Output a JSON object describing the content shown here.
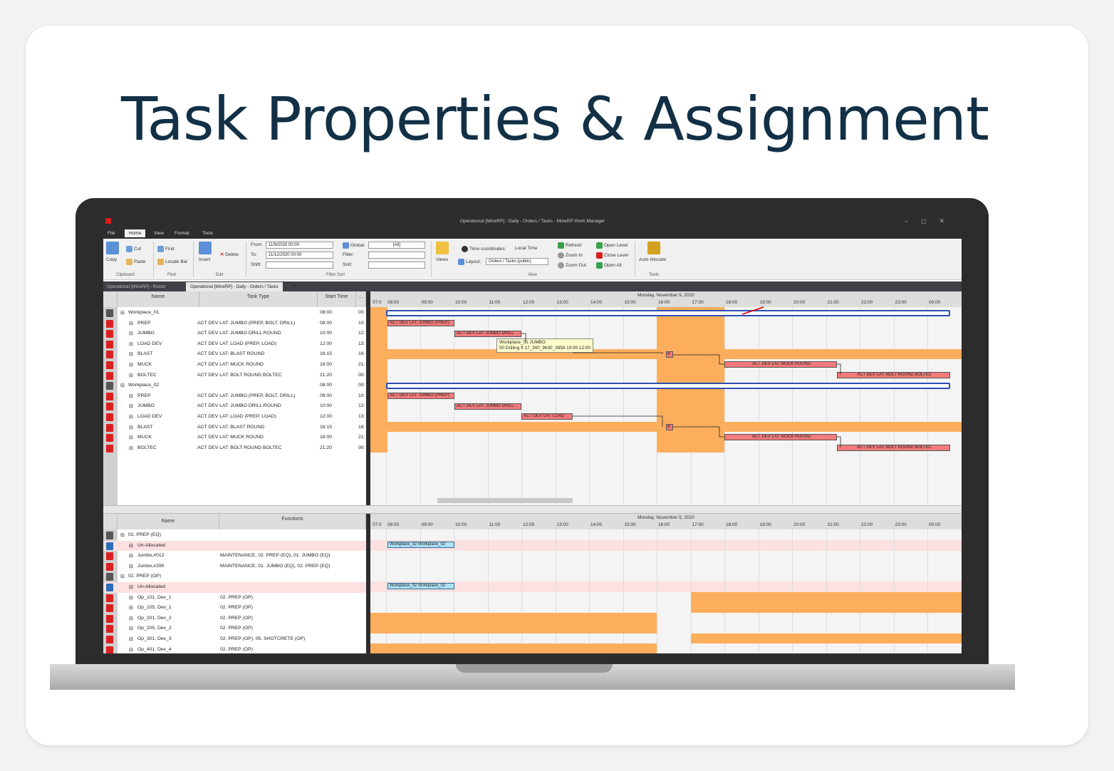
{
  "slide_title": "Task Properties & Assignment",
  "app": {
    "window_title": "Operational [MineRP] - Daily - Orders / Tasks - MineRP Work Manager",
    "menu": [
      "File",
      "Home",
      "View",
      "Format",
      "Tools"
    ],
    "ribbon": {
      "clipboard": {
        "copy": "Copy",
        "cut": "Cut",
        "paste": "Paste",
        "label": "Clipboard"
      },
      "find": {
        "find": "Find",
        "locate_bar": "Locate Bar",
        "label": "Find"
      },
      "edit": {
        "insert": "Insert",
        "delete": "Delete",
        "label": "Edit"
      },
      "filter": {
        "from_label": "From:",
        "from_value": "11/9/2020 00:00",
        "to_label": "To:",
        "to_value": "11/12/2020 00:00",
        "shift_label": "Shift:",
        "global_label": "Global:",
        "global_value": "[All]",
        "filter_label": "Filter:",
        "sort_label": "Sort:",
        "label": "Filter Sort"
      },
      "view": {
        "views": "Views",
        "time_coords_label": "Time coordinates:",
        "time_coords_value": "Local Time",
        "layout_label": "Layout:",
        "layout_value": "Orders / Tasks (public)",
        "refresh": "Refresh",
        "zoom_in": "Zoom In",
        "zoom_out": "Zoom Out",
        "open_level": "Open Level",
        "close_level": "Close Level",
        "open_all": "Open All",
        "label": "View"
      },
      "tools": {
        "auto_allocate": "Auto Allocate",
        "label": "Tools"
      }
    },
    "doc_tabs": [
      "Operational [MineRP] - Roster",
      "Operational [MineRP] - Daily - Orders / Tasks"
    ],
    "top_grid": {
      "headers": [
        "Name",
        "Task Type",
        "Start Time",
        "..."
      ],
      "rows": [
        {
          "name": "Workplace_01",
          "type": "",
          "start": "08:00",
          "end": "00:",
          "group": true
        },
        {
          "name": "PREP",
          "type": "ACT DEV LAT: JUMBO (PREP, BOLT, DRILL)",
          "start": "08:00",
          "end": "10:"
        },
        {
          "name": "JUMBO",
          "type": "ACT DEV LAT: JUMBO DRILL ROUND",
          "start": "10:00",
          "end": "12:"
        },
        {
          "name": "LOAD DEV",
          "type": "ACT DEV LAT: LOAD (PREP, LOAD)",
          "start": "12:00",
          "end": "13:"
        },
        {
          "name": "BLAST",
          "type": "ACT DEV LAT: BLAST ROUND",
          "start": "16:15",
          "end": "16:"
        },
        {
          "name": "MUCK",
          "type": "ACT DEV LAT: MUCK ROUND",
          "start": "18:00",
          "end": "21:"
        },
        {
          "name": "BOLTEC",
          "type": "ACT DEV LAT: BOLT ROUND BOLTEC",
          "start": "21:20",
          "end": "00:"
        },
        {
          "name": "Workplace_02",
          "type": "",
          "start": "08:00",
          "end": "00:",
          "group": true
        },
        {
          "name": "PREP",
          "type": "ACT DEV LAT: JUMBO (PREP, BOLT, DRILL)",
          "start": "08:00",
          "end": "10:"
        },
        {
          "name": "JUMBO",
          "type": "ACT DEV LAT: JUMBO DRILL ROUND",
          "start": "10:00",
          "end": "12:"
        },
        {
          "name": "LOAD DEV",
          "type": "ACT DEV LAT: LOAD (PREP, LOAD)",
          "start": "12:00",
          "end": "13:"
        },
        {
          "name": "BLAST",
          "type": "ACT DEV LAT: BLAST ROUND",
          "start": "16:15",
          "end": "16:"
        },
        {
          "name": "MUCK",
          "type": "ACT DEV LAT: MUCK ROUND",
          "start": "18:00",
          "end": "21:"
        },
        {
          "name": "BOLTEC",
          "type": "ACT DEV LAT: BOLT ROUND BOLTEC",
          "start": "21:20",
          "end": "00:"
        }
      ]
    },
    "gantt": {
      "date": "Monday, November 9, 2020",
      "hours": [
        "07:0",
        "08:00",
        "09:00",
        "10:00",
        "11:00",
        "12:00",
        "13:00",
        "14:00",
        "15:00",
        "16:00",
        "17:00",
        "18:00",
        "19:00",
        "20:00",
        "21:00",
        "22:00",
        "23:00",
        "00:00"
      ],
      "bars": {
        "prep": "ACT DEV LAT: JUMBO (PREP)",
        "jumbo1": "ACT DEV LAT: JUMBO DRILL",
        "jumbo2": "ACT DEV LAT: JUMBO DRILL...",
        "load": "ACT DEV LAT: LOAD",
        "blast": "B",
        "muck": "ACT DEV LAT: MUCK ROUND",
        "boltec": "ACT DEV LAT: BOLT ROUND BOLTEC"
      },
      "tooltip_line1": "Workplace_01 JUMBO",
      "tooltip_line2": "50 Drilling ft 17_300_9630_3958  10:00 12:00"
    },
    "bottom_grid": {
      "headers": [
        "Name",
        "Functions"
      ],
      "rows": [
        {
          "name": "02. PREP (EQ)",
          "func": "",
          "group": true
        },
        {
          "name": "Un-Allocated",
          "func": "",
          "pink": true
        },
        {
          "name": "Jumbo,#012",
          "func": "MAINTENANCE, 02. PREP (EQ), 01. JUMBO (EQ)"
        },
        {
          "name": "Jumbo,#290",
          "func": "MAINTENANCE, 01. JUMBO (EQ), 02. PREP (EQ)"
        },
        {
          "name": "02. PREP (OP)",
          "func": "",
          "group": true
        },
        {
          "name": "Un-Allocated",
          "func": "",
          "pink": true
        },
        {
          "name": "Op_101, Dev_1",
          "func": "02. PREP (OP)"
        },
        {
          "name": "Op_105, Dev_1",
          "func": "02. PREP (OP)"
        },
        {
          "name": "Op_201, Dev_2",
          "func": "02. PREP (OP)"
        },
        {
          "name": "Op_205, Dev_2",
          "func": "02. PREP (OP)"
        },
        {
          "name": "Op_301, Dev_3",
          "func": "02. PREP (OP), 05. SHOTCRETE (OP)"
        },
        {
          "name": "Op_401, Dev_4",
          "func": "02. PREP (OP)"
        }
      ],
      "unalloc_bar": "Workplace_02 Workplace_02"
    }
  }
}
